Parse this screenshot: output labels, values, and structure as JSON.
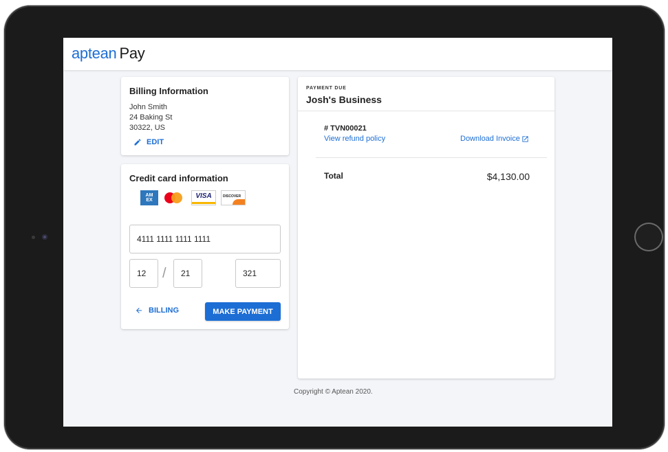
{
  "app": {
    "brand": "aptean",
    "product": "Pay"
  },
  "billing": {
    "title": "Billing Information",
    "name": "John Smith",
    "street": "24 Baking St",
    "city_zip": "30322, US",
    "edit_label": "EDIT"
  },
  "credit_card": {
    "title": "Credit card information",
    "brands": {
      "amex_top": "AM",
      "amex_bottom": "EX",
      "visa": "VISA",
      "discover": "DISCOVER"
    },
    "number": "4111 1111 1111 1111",
    "month": "12",
    "year": "21",
    "cvv": "321",
    "separator": "/",
    "back_label": "BILLING",
    "pay_label": "MAKE PAYMENT"
  },
  "payment_due": {
    "label": "PAYMENT DUE",
    "business": "Josh's Business",
    "invoice": "# TVN00021",
    "refund_link": "View refund policy",
    "download_link": "Download Invoice",
    "total_label": "Total",
    "total_value": "$4,130.00"
  },
  "footer": {
    "copyright": "Copyright © Aptean 2020."
  },
  "colors": {
    "accent": "#1c6ed4",
    "background": "#f4f5f9"
  }
}
